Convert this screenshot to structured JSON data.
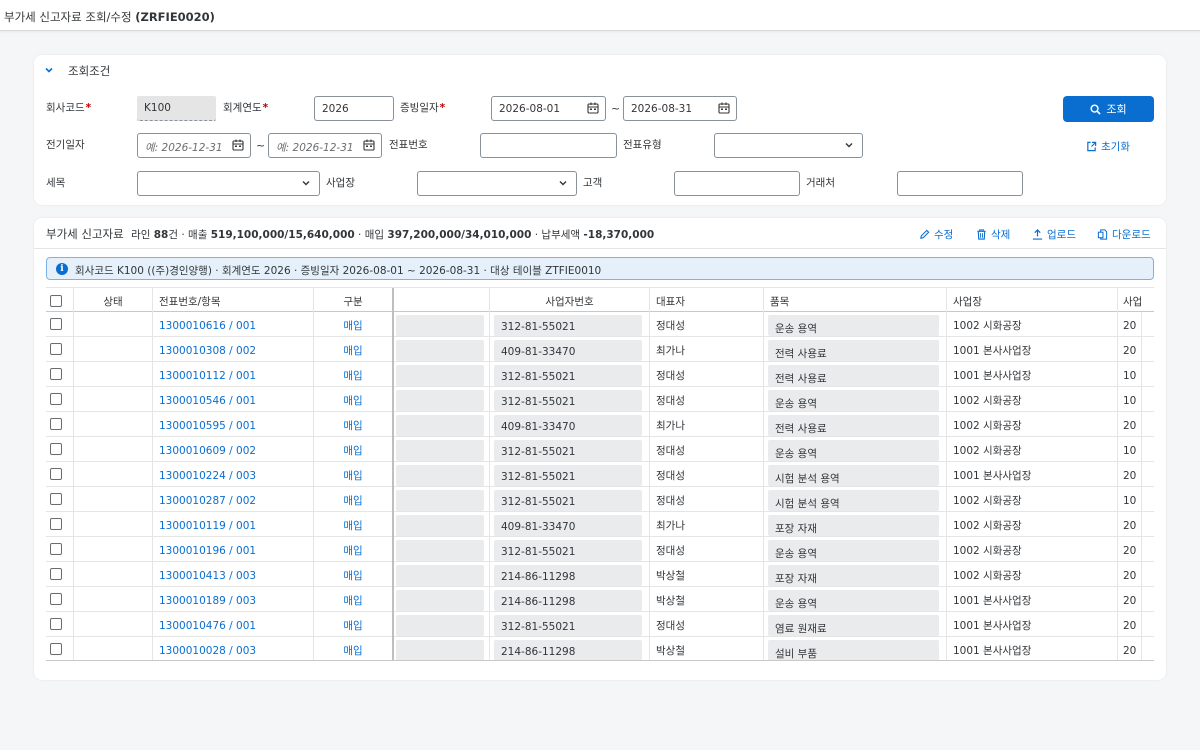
{
  "app": {
    "title_prefix": "부가세 신고자료 조회/수정",
    "title_code": "(ZRFIE0020)"
  },
  "filter": {
    "section_title": "조회조건",
    "company_label": "회사코드",
    "company_value": "K100",
    "fiscal_year_label": "회계연도",
    "fiscal_year_value": "2026",
    "doc_date_label": "증빙일자",
    "doc_date_from": "2026-08-01",
    "doc_date_to": "2026-08-31",
    "posting_date_label": "전기일자",
    "posting_date_from_ph": "예: 2026-12-31",
    "posting_date_to_ph": "예: 2026-12-31",
    "doc_no_label": "전표번호",
    "doc_no_value": "",
    "doc_type_label": "전표유형",
    "doc_type_value": "",
    "tax_item_label": "세목",
    "tax_item_value": "",
    "business_place_label": "사업장",
    "business_place_value": "",
    "customer_label": "고객",
    "customer_value": "",
    "vendor_label": "거래처",
    "vendor_value": "",
    "tilde": "~",
    "search_button": "조회",
    "reset_button": "초기화"
  },
  "result": {
    "title": "부가세 신고자료",
    "summary_line_label": "라인",
    "summary_line_count": "88",
    "summary_line_unit": "건 · 매출",
    "summary_sales": "519,100,000/15,640,000",
    "summary_purchase_label": "· 매입",
    "summary_purchase": "397,200,000/34,010,000",
    "summary_payable_label": "· 납부세액",
    "summary_payable": "-18,370,000",
    "toolbar": {
      "edit": "수정",
      "delete": "삭제",
      "upload": "업로드",
      "download": "다운로드"
    },
    "info": "회사코드 K100 ((주)경인양행) · 회계연도 2026 · 증빙일자 2026-08-01 ~ 2026-08-31 · 대상 테이블 ZTFIE0010",
    "columns": {
      "status": "상태",
      "doc": "전표번호/항목",
      "type": "구분",
      "blank": "",
      "bizno": "사업자번호",
      "rep": "대표자",
      "item": "품목",
      "place": "사업장",
      "next": "사업"
    },
    "rows": [
      {
        "doc": "1300010616 / 001",
        "type": "매입",
        "bizno": "312-81-55021",
        "rep": "정대성",
        "item": "운송 용역",
        "place": "1002 시화공장",
        "next": "20"
      },
      {
        "doc": "1300010308 / 002",
        "type": "매입",
        "bizno": "409-81-33470",
        "rep": "최가나",
        "item": "전력 사용료",
        "place": "1001 본사사업장",
        "next": "20"
      },
      {
        "doc": "1300010112 / 001",
        "type": "매입",
        "bizno": "312-81-55021",
        "rep": "정대성",
        "item": "전력 사용료",
        "place": "1001 본사사업장",
        "next": "10"
      },
      {
        "doc": "1300010546 / 001",
        "type": "매입",
        "bizno": "312-81-55021",
        "rep": "정대성",
        "item": "운송 용역",
        "place": "1002 시화공장",
        "next": "10"
      },
      {
        "doc": "1300010595 / 001",
        "type": "매입",
        "bizno": "409-81-33470",
        "rep": "최가나",
        "item": "전력 사용료",
        "place": "1002 시화공장",
        "next": "20"
      },
      {
        "doc": "1300010609 / 002",
        "type": "매입",
        "bizno": "312-81-55021",
        "rep": "정대성",
        "item": "운송 용역",
        "place": "1002 시화공장",
        "next": "10"
      },
      {
        "doc": "1300010224 / 003",
        "type": "매입",
        "bizno": "312-81-55021",
        "rep": "정대성",
        "item": "시험 분석 용역",
        "place": "1001 본사사업장",
        "next": "20"
      },
      {
        "doc": "1300010287 / 002",
        "type": "매입",
        "bizno": "312-81-55021",
        "rep": "정대성",
        "item": "시험 분석 용역",
        "place": "1002 시화공장",
        "next": "10"
      },
      {
        "doc": "1300010119 / 001",
        "type": "매입",
        "bizno": "409-81-33470",
        "rep": "최가나",
        "item": "포장 자재",
        "place": "1002 시화공장",
        "next": "20"
      },
      {
        "doc": "1300010196 / 001",
        "type": "매입",
        "bizno": "312-81-55021",
        "rep": "정대성",
        "item": "운송 용역",
        "place": "1002 시화공장",
        "next": "20"
      },
      {
        "doc": "1300010413 / 003",
        "type": "매입",
        "bizno": "214-86-11298",
        "rep": "박상철",
        "item": "포장 자재",
        "place": "1002 시화공장",
        "next": "20"
      },
      {
        "doc": "1300010189 / 003",
        "type": "매입",
        "bizno": "214-86-11298",
        "rep": "박상철",
        "item": "운송 용역",
        "place": "1001 본사사업장",
        "next": "20"
      },
      {
        "doc": "1300010476 / 001",
        "type": "매입",
        "bizno": "312-81-55021",
        "rep": "정대성",
        "item": "염료 원재료",
        "place": "1001 본사사업장",
        "next": "20"
      },
      {
        "doc": "1300010028 / 003",
        "type": "매입",
        "bizno": "214-86-11298",
        "rep": "박상철",
        "item": "설비 부품",
        "place": "1001 본사사업장",
        "next": "20"
      }
    ]
  },
  "colors": {
    "accent": "#0a6ed1",
    "required": "#bb0000",
    "info_bg": "#e5f0fa"
  }
}
